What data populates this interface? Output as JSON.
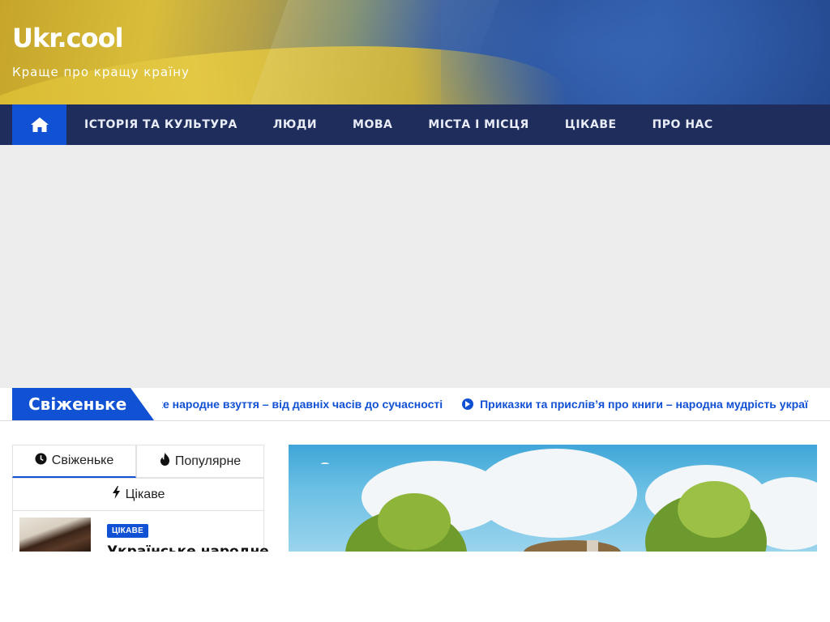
{
  "site": {
    "title": "Ukr.cool",
    "tagline": "Краще про кращу країну"
  },
  "nav": {
    "home_icon": "home-icon",
    "items": [
      {
        "label": "ІСТОРІЯ ТА КУЛЬТУРА"
      },
      {
        "label": "ЛЮДИ"
      },
      {
        "label": "МОВА"
      },
      {
        "label": "МІСТА І МІСЦЯ"
      },
      {
        "label": "ЦІКАВЕ"
      },
      {
        "label": "ПРО НАС"
      }
    ]
  },
  "ticker": {
    "label": "Свіженьке",
    "items": [
      {
        "text": "ке народне взуття – від давніх часів до сучасності"
      },
      {
        "text": "Приказки та прислів’я про книги – народна мудрість украї"
      }
    ]
  },
  "sidebar": {
    "tabs": [
      {
        "label": "Свіженьке",
        "icon": "clock-icon"
      },
      {
        "label": "Популярне",
        "icon": "fire-icon"
      },
      {
        "label": "Цікаве",
        "icon": "bolt-icon"
      }
    ],
    "post": {
      "badge": "ЦІКАВЕ",
      "title": "Українське народне"
    }
  },
  "colors": {
    "accent": "#1151d3",
    "nav_bg": "#1f2d5c",
    "ad_bg": "#ededed"
  }
}
